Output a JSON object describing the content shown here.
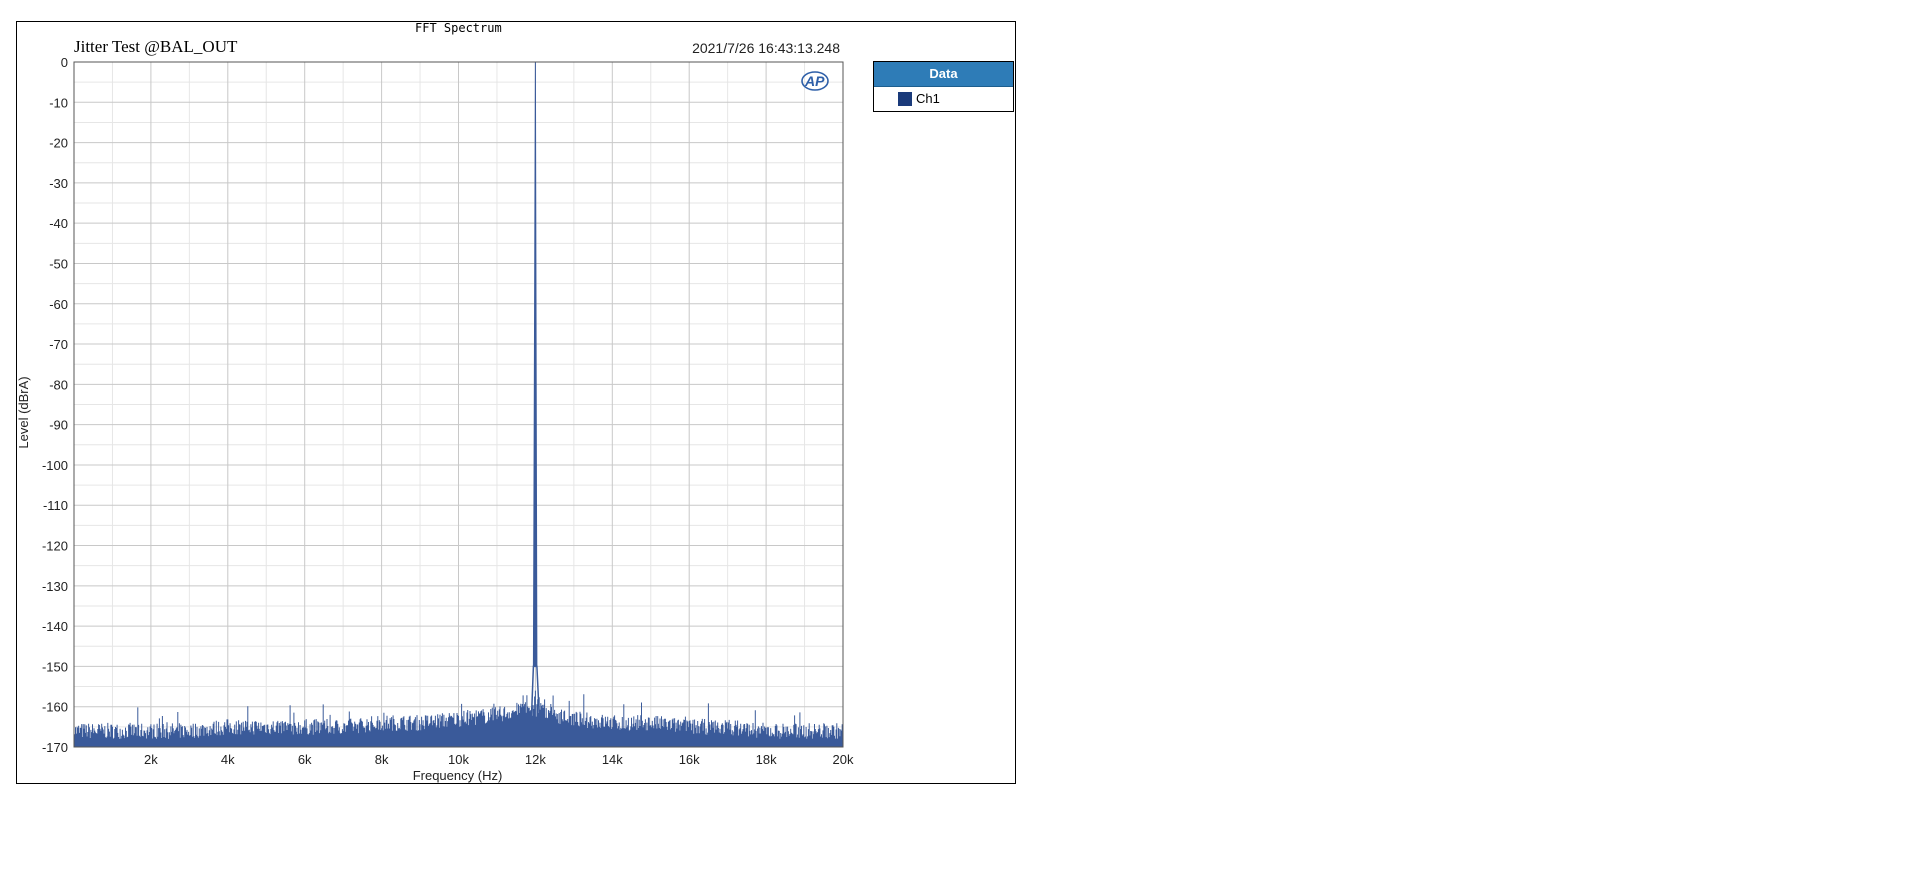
{
  "chart_data": {
    "type": "line",
    "title": "FFT Spectrum",
    "subtitle": "Jitter Test @BAL_OUT",
    "timestamp": "2021/7/26 16:43:13.248",
    "xlabel": "Frequency (Hz)",
    "ylabel": "Level (dBrA)",
    "xlim": [
      0,
      20000
    ],
    "ylim": [
      -170,
      0
    ],
    "x_ticks": [
      "2k",
      "4k",
      "6k",
      "8k",
      "10k",
      "12k",
      "14k",
      "16k",
      "18k",
      "20k"
    ],
    "y_ticks": [
      "0",
      "-10",
      "-20",
      "-30",
      "-40",
      "-50",
      "-60",
      "-70",
      "-80",
      "-90",
      "-100",
      "-110",
      "-120",
      "-130",
      "-140",
      "-150",
      "-160",
      "-170"
    ],
    "grid": true,
    "legend_position": "right",
    "series": [
      {
        "name": "Ch1",
        "color": "#3a5a9a",
        "peak": {
          "x": 12000,
          "y": 0
        },
        "noise_floor": [
          {
            "x": 0,
            "y": -166
          },
          {
            "x": 1000,
            "y": -166
          },
          {
            "x": 2000,
            "y": -166
          },
          {
            "x": 3000,
            "y": -166
          },
          {
            "x": 4000,
            "y": -165
          },
          {
            "x": 5000,
            "y": -165
          },
          {
            "x": 6000,
            "y": -165
          },
          {
            "x": 7000,
            "y": -165
          },
          {
            "x": 8000,
            "y": -164
          },
          {
            "x": 9000,
            "y": -164
          },
          {
            "x": 10000,
            "y": -163
          },
          {
            "x": 11000,
            "y": -162
          },
          {
            "x": 11500,
            "y": -161
          },
          {
            "x": 12500,
            "y": -162
          },
          {
            "x": 13000,
            "y": -163
          },
          {
            "x": 14000,
            "y": -164
          },
          {
            "x": 15000,
            "y": -164
          },
          {
            "x": 16000,
            "y": -165
          },
          {
            "x": 17000,
            "y": -165
          },
          {
            "x": 18000,
            "y": -166
          },
          {
            "x": 19000,
            "y": -166
          },
          {
            "x": 20000,
            "y": -166
          }
        ]
      }
    ]
  },
  "legend": {
    "header": "Data",
    "items": [
      {
        "label": "Ch1",
        "color": "#1a3a7a"
      }
    ]
  },
  "logo": {
    "text": "AP"
  }
}
